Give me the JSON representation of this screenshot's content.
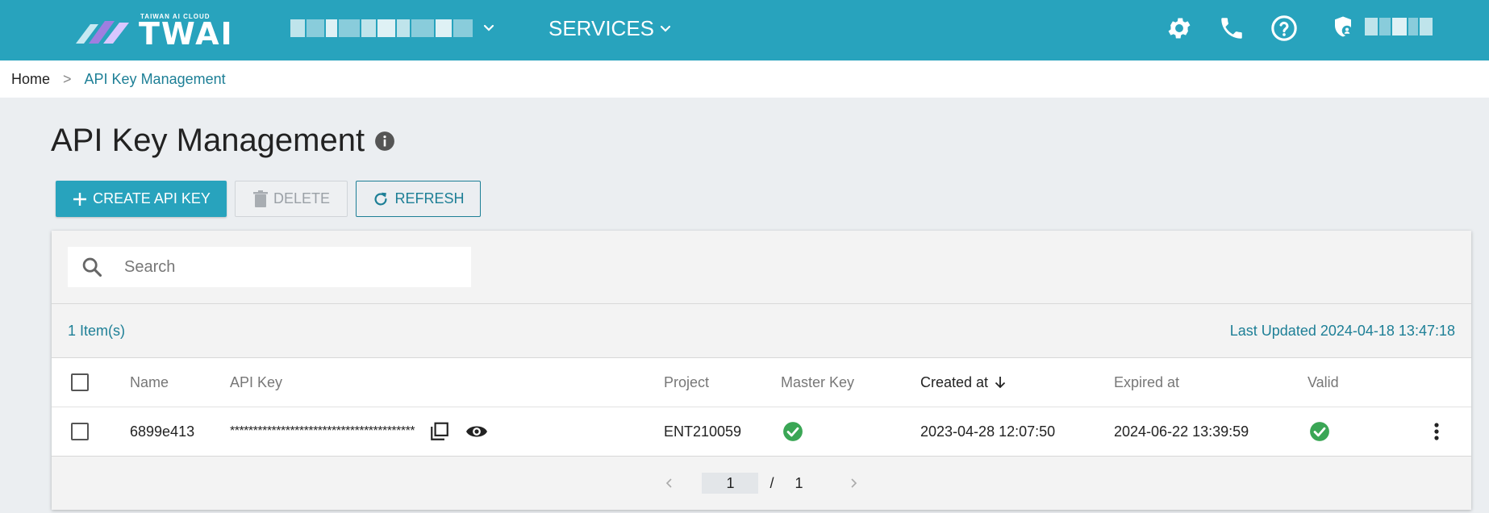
{
  "header": {
    "logo_subtitle": "TAIWAN AI CLOUD",
    "logo_text": "TWAI",
    "services_label": "SERVICES",
    "icons": [
      "gear-icon",
      "phone-icon",
      "help-icon",
      "user-shield-icon"
    ]
  },
  "breadcrumb": {
    "home": "Home",
    "separator": ">",
    "current": "API Key Management"
  },
  "page": {
    "title": "API Key Management"
  },
  "toolbar": {
    "create_label": "CREATE API KEY",
    "delete_label": "DELETE",
    "refresh_label": "REFRESH"
  },
  "search": {
    "placeholder": "Search",
    "value": ""
  },
  "summary": {
    "items": "1 Item(s)",
    "last_updated": "Last Updated 2024-04-18 13:47:18"
  },
  "table": {
    "columns": {
      "name": "Name",
      "api_key": "API Key",
      "project": "Project",
      "master_key": "Master Key",
      "created_at": "Created at",
      "expired_at": "Expired at",
      "valid": "Valid"
    },
    "rows": [
      {
        "name": "6899e413",
        "api_key": "****************************************",
        "project": "ENT210059",
        "master_key": true,
        "created_at": "2023-04-28 12:07:50",
        "expired_at": "2024-06-22 13:39:59",
        "valid": true
      }
    ]
  },
  "pagination": {
    "current": "1",
    "separator": "/",
    "total": "1"
  },
  "colors": {
    "brand": "#28a3bd",
    "accent_text": "#1d7f96",
    "success": "#3aa655"
  }
}
